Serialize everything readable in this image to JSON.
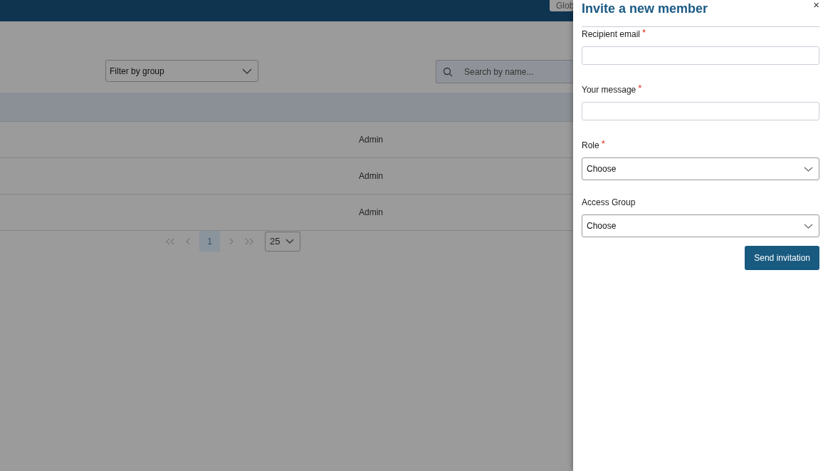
{
  "header": {
    "button": "Glob"
  },
  "toolbar": {
    "filter": {
      "placeholder": "Filter by group"
    },
    "search": {
      "placeholder": "Search by name..."
    }
  },
  "table": {
    "rows": [
      {
        "column_1": "Admin"
      },
      {
        "column_1": "Admin"
      },
      {
        "column_1": "Admin"
      }
    ]
  },
  "pagination": {
    "pages": [
      {
        "label": "1",
        "selected": true
      }
    ],
    "page_size": "25"
  },
  "drawer": {
    "title": "Invite a new member",
    "close": "×",
    "fields": [
      {
        "kind": "text",
        "label": "Recipient email",
        "required_mark": "*"
      },
      {
        "kind": "text",
        "label": "Your message",
        "required_mark": "*"
      },
      {
        "kind": "select",
        "label": "Role",
        "required_mark": "*",
        "value": "Choose"
      },
      {
        "kind": "select",
        "label": "Access Group",
        "value": "Choose"
      }
    ],
    "submit": "Send invitation"
  }
}
